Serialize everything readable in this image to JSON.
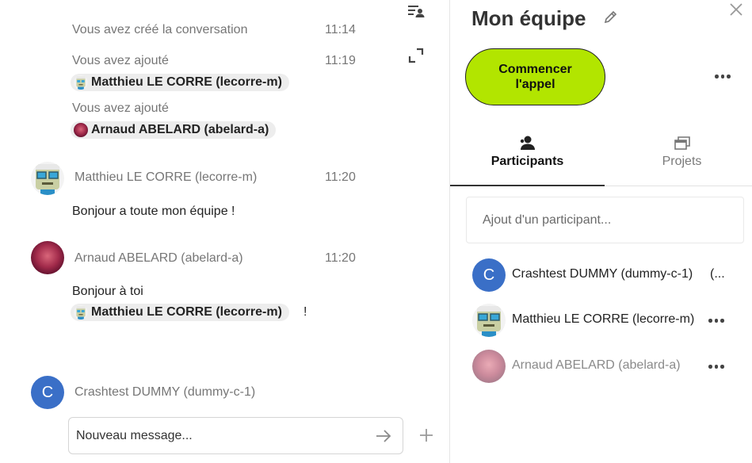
{
  "chat": {
    "events": [
      {
        "text": "Vous avez créé la conversation",
        "time": "11:14"
      },
      {
        "text": "Vous avez ajouté",
        "time": "11:19",
        "mention": "Matthieu LE CORRE (lecorre-m)"
      },
      {
        "text": "Vous avez ajouté",
        "mention": "Arnaud ABELARD (abelard-a)"
      }
    ],
    "messages": [
      {
        "author": "Matthieu LE CORRE (lecorre-m)",
        "time": "11:20",
        "text": "Bonjour a toute mon équipe !"
      },
      {
        "author": "Arnaud ABELARD (abelard-a)",
        "time": "11:20",
        "text": "Bonjour à toi",
        "mention": "Matthieu LE CORRE (lecorre-m)",
        "suffix": "!"
      }
    ],
    "current_user": {
      "initial": "C",
      "name": "Crashtest DUMMY (dummy-c-1)"
    },
    "composer": {
      "placeholder": "Nouveau message..."
    }
  },
  "sidebar": {
    "title": "Mon équipe",
    "call_button": "Commencer l'appel",
    "tabs": [
      {
        "label": "Participants",
        "icon": "people-icon"
      },
      {
        "label": "Projets",
        "icon": "projects-icon"
      }
    ],
    "add_participant_placeholder": "Ajout d'un participant...",
    "participants": [
      {
        "initial": "C",
        "name": "Crashtest DUMMY (dummy-c-1)",
        "status": "(..."
      },
      {
        "name": "Matthieu LE CORRE (lecorre-m)"
      },
      {
        "name": "Arnaud ABELARD (abelard-a)"
      }
    ]
  },
  "colors": {
    "call_button": "#b2e500",
    "avatar_blue": "#3a6fc7",
    "mention_bg": "#ededed"
  }
}
